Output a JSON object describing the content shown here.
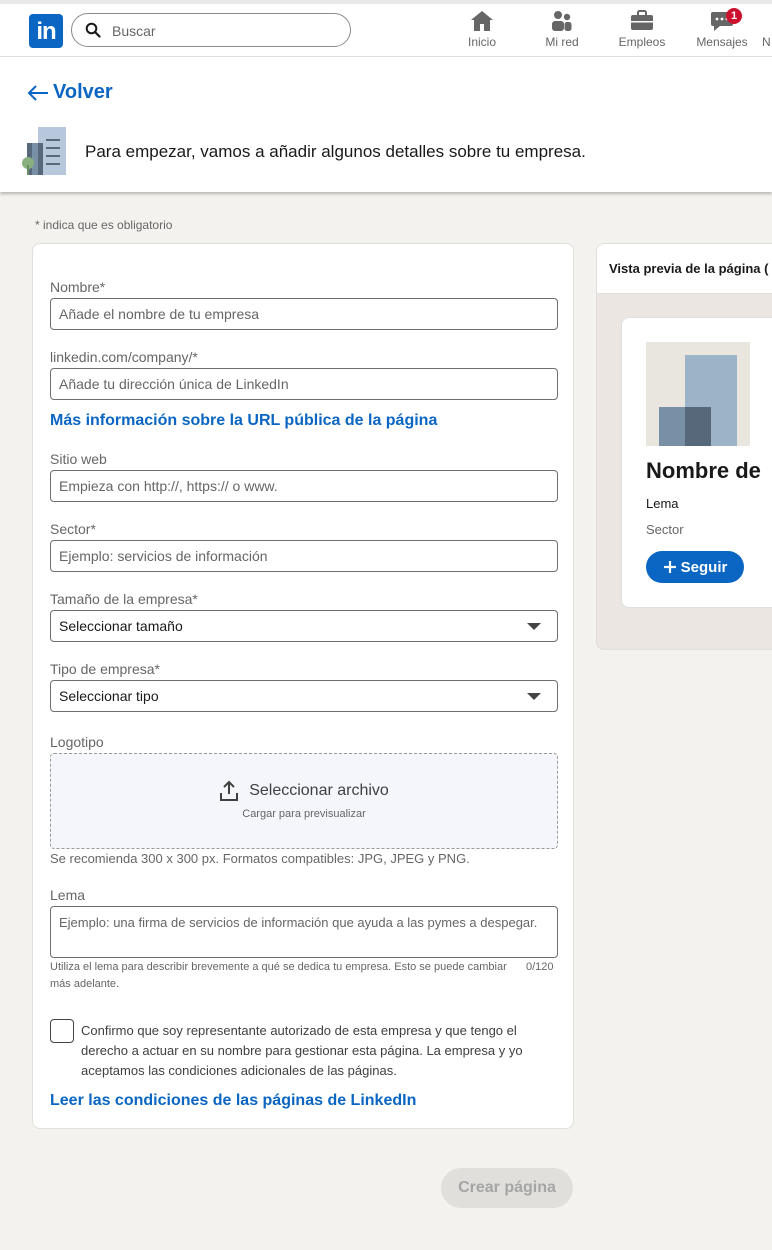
{
  "nav": {
    "logo_text": "in",
    "search_placeholder": "Buscar",
    "items": [
      {
        "label": "Inicio",
        "icon": "home-icon"
      },
      {
        "label": "Mi red",
        "icon": "network-icon"
      },
      {
        "label": "Empleos",
        "icon": "briefcase-icon"
      },
      {
        "label": "Mensajes",
        "icon": "messaging-icon",
        "badge": "1"
      },
      {
        "label": "N",
        "icon": "notifications-icon"
      }
    ]
  },
  "header": {
    "back_label": "Volver",
    "intro_text": "Para empezar, vamos a añadir algunos detalles sobre tu empresa."
  },
  "required_note": "*  indica que es obligatorio",
  "form": {
    "name_label": "Nombre*",
    "name_placeholder": "Añade el nombre de tu empresa",
    "url_label": "linkedin.com/company/*",
    "url_placeholder": "Añade tu dirección única de LinkedIn",
    "url_link": "Más información sobre la URL pública de la página",
    "website_label": "Sitio web",
    "website_placeholder": "Empieza con http://, https:// o www.",
    "industry_label": "Sector*",
    "industry_placeholder": "Ejemplo: servicios de información",
    "size_label": "Tamaño de la empresa*",
    "size_value": "Seleccionar tamaño",
    "type_label": "Tipo de empresa*",
    "type_value": "Seleccionar tipo",
    "logo_label": "Logotipo",
    "upload_title": "Seleccionar archivo",
    "upload_sub": "Cargar para previsualizar",
    "logo_hint": "Se recomienda 300 x 300 px. Formatos compatibles: JPG, JPEG y PNG.",
    "tagline_label": "Lema",
    "tagline_placeholder": "Ejemplo: una firma de servicios de información que ayuda a las pymes a despegar.",
    "tagline_hint": "Utiliza el lema para describir brevemente a qué se dedica tu empresa. Esto se puede cambiar más adelante.",
    "tagline_counter": "0/120",
    "confirm_text": "Confirmo que soy representante autorizado de esta empresa y que tengo el derecho a actuar en su nombre para gestionar esta página. La empresa y yo aceptamos las condiciones adicionales de las páginas.",
    "terms_link": "Leer las condiciones de las páginas de LinkedIn"
  },
  "preview": {
    "title": "Vista previa de la página (",
    "company_name": "Nombre de",
    "tagline": "Lema",
    "industry": "Sector",
    "follow_label": "Seguir"
  },
  "create_button": "Crear página",
  "colors": {
    "accent": "#0a66c2",
    "background": "#f4f2ee",
    "badge": "#cb112d"
  }
}
